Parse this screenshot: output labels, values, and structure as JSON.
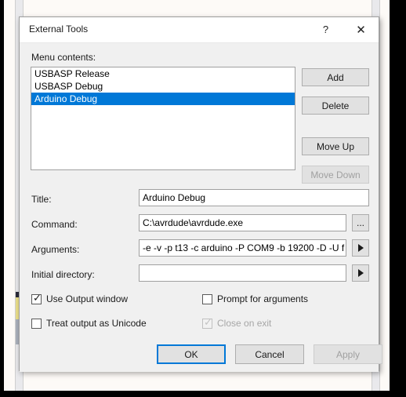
{
  "window": {
    "title": "External Tools",
    "help_label": "?",
    "close_label": "✕"
  },
  "menu_contents": {
    "label": "Menu contents:",
    "items": [
      {
        "label": "USBASP Release",
        "selected": false
      },
      {
        "label": "USBASP Debug",
        "selected": false
      },
      {
        "label": "Arduino Debug",
        "selected": true
      }
    ]
  },
  "side_buttons": {
    "add": "Add",
    "delete": "Delete",
    "move_up": "Move Up",
    "move_down": "Move Down"
  },
  "fields": {
    "title": {
      "label": "Title:",
      "value": "Arduino Debug"
    },
    "command": {
      "label": "Command:",
      "value": "C:\\avrdude\\avrdude.exe",
      "browse_label": "..."
    },
    "arguments": {
      "label": "Arguments:",
      "value": "-e -v -p t13 -c arduino -P COM9 -b 19200 -D -U f",
      "expand_label": "▶"
    },
    "initial_directory": {
      "label": "Initial directory:",
      "value": "",
      "expand_label": "▶"
    }
  },
  "checkboxes": {
    "use_output_window": {
      "label": "Use Output window",
      "checked": true,
      "enabled": true,
      "mark": "✓"
    },
    "prompt_for_arguments": {
      "label": "Prompt for arguments",
      "checked": false,
      "enabled": true,
      "mark": ""
    },
    "treat_output_as_unicode": {
      "label": "Treat output as Unicode",
      "checked": false,
      "enabled": true,
      "mark": ""
    },
    "close_on_exit": {
      "label": "Close on exit",
      "checked": true,
      "enabled": false,
      "mark": "✓"
    }
  },
  "footer": {
    "ok": "OK",
    "cancel": "Cancel",
    "apply": "Apply"
  },
  "colors": {
    "selection": "#0078d7",
    "dialog_bg": "#f0f0f0",
    "focus_border": "#0078d7",
    "marker_yellow": "#ecdf8a"
  }
}
